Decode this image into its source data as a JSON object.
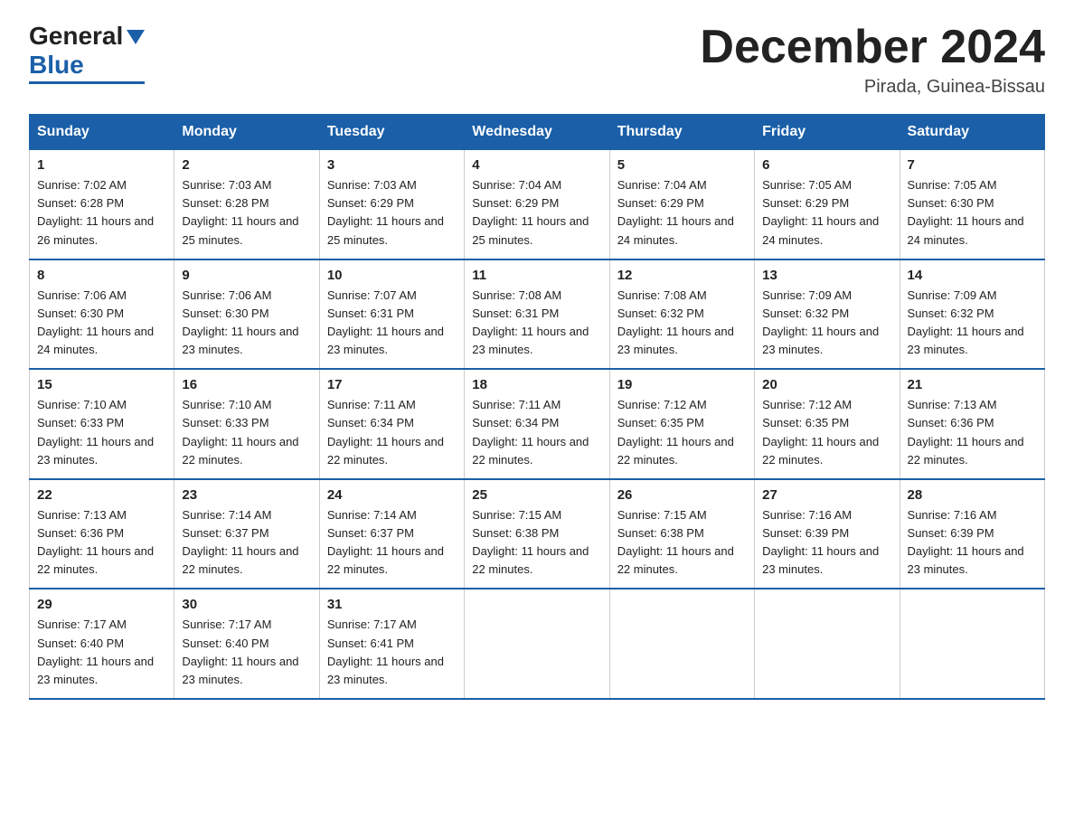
{
  "logo": {
    "general": "General",
    "blue": "Blue"
  },
  "header": {
    "month_title": "December 2024",
    "location": "Pirada, Guinea-Bissau"
  },
  "days_of_week": [
    "Sunday",
    "Monday",
    "Tuesday",
    "Wednesday",
    "Thursday",
    "Friday",
    "Saturday"
  ],
  "weeks": [
    [
      {
        "day": "1",
        "sunrise": "7:02 AM",
        "sunset": "6:28 PM",
        "daylight": "11 hours and 26 minutes."
      },
      {
        "day": "2",
        "sunrise": "7:03 AM",
        "sunset": "6:28 PM",
        "daylight": "11 hours and 25 minutes."
      },
      {
        "day": "3",
        "sunrise": "7:03 AM",
        "sunset": "6:29 PM",
        "daylight": "11 hours and 25 minutes."
      },
      {
        "day": "4",
        "sunrise": "7:04 AM",
        "sunset": "6:29 PM",
        "daylight": "11 hours and 25 minutes."
      },
      {
        "day": "5",
        "sunrise": "7:04 AM",
        "sunset": "6:29 PM",
        "daylight": "11 hours and 24 minutes."
      },
      {
        "day": "6",
        "sunrise": "7:05 AM",
        "sunset": "6:29 PM",
        "daylight": "11 hours and 24 minutes."
      },
      {
        "day": "7",
        "sunrise": "7:05 AM",
        "sunset": "6:30 PM",
        "daylight": "11 hours and 24 minutes."
      }
    ],
    [
      {
        "day": "8",
        "sunrise": "7:06 AM",
        "sunset": "6:30 PM",
        "daylight": "11 hours and 24 minutes."
      },
      {
        "day": "9",
        "sunrise": "7:06 AM",
        "sunset": "6:30 PM",
        "daylight": "11 hours and 23 minutes."
      },
      {
        "day": "10",
        "sunrise": "7:07 AM",
        "sunset": "6:31 PM",
        "daylight": "11 hours and 23 minutes."
      },
      {
        "day": "11",
        "sunrise": "7:08 AM",
        "sunset": "6:31 PM",
        "daylight": "11 hours and 23 minutes."
      },
      {
        "day": "12",
        "sunrise": "7:08 AM",
        "sunset": "6:32 PM",
        "daylight": "11 hours and 23 minutes."
      },
      {
        "day": "13",
        "sunrise": "7:09 AM",
        "sunset": "6:32 PM",
        "daylight": "11 hours and 23 minutes."
      },
      {
        "day": "14",
        "sunrise": "7:09 AM",
        "sunset": "6:32 PM",
        "daylight": "11 hours and 23 minutes."
      }
    ],
    [
      {
        "day": "15",
        "sunrise": "7:10 AM",
        "sunset": "6:33 PM",
        "daylight": "11 hours and 23 minutes."
      },
      {
        "day": "16",
        "sunrise": "7:10 AM",
        "sunset": "6:33 PM",
        "daylight": "11 hours and 22 minutes."
      },
      {
        "day": "17",
        "sunrise": "7:11 AM",
        "sunset": "6:34 PM",
        "daylight": "11 hours and 22 minutes."
      },
      {
        "day": "18",
        "sunrise": "7:11 AM",
        "sunset": "6:34 PM",
        "daylight": "11 hours and 22 minutes."
      },
      {
        "day": "19",
        "sunrise": "7:12 AM",
        "sunset": "6:35 PM",
        "daylight": "11 hours and 22 minutes."
      },
      {
        "day": "20",
        "sunrise": "7:12 AM",
        "sunset": "6:35 PM",
        "daylight": "11 hours and 22 minutes."
      },
      {
        "day": "21",
        "sunrise": "7:13 AM",
        "sunset": "6:36 PM",
        "daylight": "11 hours and 22 minutes."
      }
    ],
    [
      {
        "day": "22",
        "sunrise": "7:13 AM",
        "sunset": "6:36 PM",
        "daylight": "11 hours and 22 minutes."
      },
      {
        "day": "23",
        "sunrise": "7:14 AM",
        "sunset": "6:37 PM",
        "daylight": "11 hours and 22 minutes."
      },
      {
        "day": "24",
        "sunrise": "7:14 AM",
        "sunset": "6:37 PM",
        "daylight": "11 hours and 22 minutes."
      },
      {
        "day": "25",
        "sunrise": "7:15 AM",
        "sunset": "6:38 PM",
        "daylight": "11 hours and 22 minutes."
      },
      {
        "day": "26",
        "sunrise": "7:15 AM",
        "sunset": "6:38 PM",
        "daylight": "11 hours and 22 minutes."
      },
      {
        "day": "27",
        "sunrise": "7:16 AM",
        "sunset": "6:39 PM",
        "daylight": "11 hours and 23 minutes."
      },
      {
        "day": "28",
        "sunrise": "7:16 AM",
        "sunset": "6:39 PM",
        "daylight": "11 hours and 23 minutes."
      }
    ],
    [
      {
        "day": "29",
        "sunrise": "7:17 AM",
        "sunset": "6:40 PM",
        "daylight": "11 hours and 23 minutes."
      },
      {
        "day": "30",
        "sunrise": "7:17 AM",
        "sunset": "6:40 PM",
        "daylight": "11 hours and 23 minutes."
      },
      {
        "day": "31",
        "sunrise": "7:17 AM",
        "sunset": "6:41 PM",
        "daylight": "11 hours and 23 minutes."
      },
      null,
      null,
      null,
      null
    ]
  ]
}
